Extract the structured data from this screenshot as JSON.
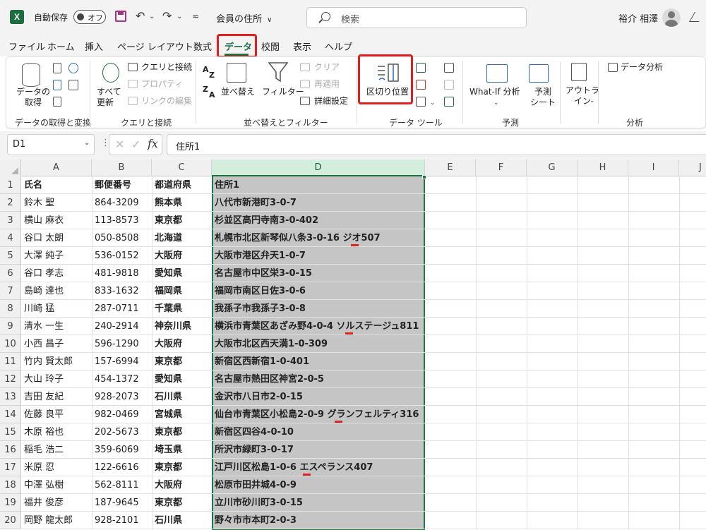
{
  "titlebar": {
    "logo": "X",
    "autosave_label": "自動保存",
    "autosave_state": "オフ",
    "filename": "会員の住所",
    "filename_chevron": "∨",
    "search_placeholder": "検索",
    "username": "裕介 相澤"
  },
  "tabs": [
    "ファイル",
    "ホーム",
    "挿入",
    "ページ レイアウト",
    "数式",
    "データ",
    "校閲",
    "表示",
    "ヘルプ"
  ],
  "active_tab": "データ",
  "ribbon": {
    "get_data": "データの\n取得",
    "group_get": "データの取得と変換",
    "queries_connections": "クエリと接続",
    "properties": "プロパティ",
    "edit_links": "リンクの編集",
    "refresh_all": "すべて\n更新",
    "group_queries": "クエリと接続",
    "sort": "並べ替え",
    "filter": "フィルター",
    "clear": "クリア",
    "reapply": "再適用",
    "advanced": "詳細設定",
    "group_sort": "並べ替えとフィルター",
    "text_to_columns": "区切り位置",
    "group_tools": "データ ツール",
    "what_if": "What-If 分析",
    "forecast_sheet": "予測\nシート",
    "group_forecast": "予測",
    "outline": "アウトラ\nイン",
    "data_analysis": "データ分析",
    "group_analysis": "分析",
    "sort_az_top": "A",
    "sort_az_bottom": "Z"
  },
  "formula_bar": {
    "namebox": "D1",
    "fx": "fx",
    "content": "住所1"
  },
  "columns": [
    "A",
    "B",
    "C",
    "D",
    "E",
    "F",
    "G",
    "H",
    "I",
    "J"
  ],
  "rows": [
    {
      "n": "1",
      "a": "氏名",
      "b": "郵便番号",
      "c": "都道府県",
      "d": "住所1"
    },
    {
      "n": "2",
      "a": "鈴木 聖",
      "b": "864-3209",
      "c": "熊本県",
      "d": "八代市新港町3-0-7"
    },
    {
      "n": "3",
      "a": "横山 麻衣",
      "b": "113-8573",
      "c": "東京都",
      "d": "杉並区高円寺南3-0-402"
    },
    {
      "n": "4",
      "a": "谷口 太朗",
      "b": "050-8508",
      "c": "北海道",
      "d": "札幌市北区新琴似八条3-0-16 ジオ507"
    },
    {
      "n": "5",
      "a": "大澤 純子",
      "b": "536-0152",
      "c": "大阪府",
      "d": "大阪市港区弁天1-0-7"
    },
    {
      "n": "6",
      "a": "谷口 孝志",
      "b": "481-9818",
      "c": "愛知県",
      "d": "名古屋市中区栄3-0-15"
    },
    {
      "n": "7",
      "a": "島崎 達也",
      "b": "833-1632",
      "c": "福岡県",
      "d": "福岡市南区日佐3-0-6"
    },
    {
      "n": "8",
      "a": "川崎 猛",
      "b": "287-0711",
      "c": "千葉県",
      "d": "我孫子市我孫子3-0-8"
    },
    {
      "n": "9",
      "a": "清水 一生",
      "b": "240-2914",
      "c": "神奈川県",
      "d": "横浜市青葉区あざみ野4-0-4 ソルステージュ811"
    },
    {
      "n": "10",
      "a": "小西 昌子",
      "b": "596-1290",
      "c": "大阪府",
      "d": "大阪市北区西天満1-0-309"
    },
    {
      "n": "11",
      "a": "竹内 賢太郎",
      "b": "157-6994",
      "c": "東京都",
      "d": "新宿区西新宿1-0-401"
    },
    {
      "n": "12",
      "a": "大山 玲子",
      "b": "454-1372",
      "c": "愛知県",
      "d": "名古屋市熱田区神宮2-0-5"
    },
    {
      "n": "13",
      "a": "吉田 友紀",
      "b": "928-2073",
      "c": "石川県",
      "d": "金沢市八日市2-0-15"
    },
    {
      "n": "14",
      "a": "佐藤 良平",
      "b": "982-0469",
      "c": "宮城県",
      "d": "仙台市青葉区小松島2-0-9 グランフェルティ316"
    },
    {
      "n": "15",
      "a": "木原 裕也",
      "b": "202-5673",
      "c": "東京都",
      "d": "新宿区四谷4-0-10"
    },
    {
      "n": "16",
      "a": "稲毛 浩二",
      "b": "359-6069",
      "c": "埼玉県",
      "d": "所沢市緑町3-0-17"
    },
    {
      "n": "17",
      "a": "米原 忍",
      "b": "122-6616",
      "c": "東京都",
      "d": "江戸川区松島1-0-6 エスペランス407"
    },
    {
      "n": "18",
      "a": "中澤 弘樹",
      "b": "562-8111",
      "c": "大阪府",
      "d": "松原市田井城4-0-9"
    },
    {
      "n": "19",
      "a": "福井 俊彦",
      "b": "187-9645",
      "c": "東京都",
      "d": "立川市砂川町3-0-15"
    },
    {
      "n": "20",
      "a": "岡野 龍太郎",
      "b": "928-2101",
      "c": "石川県",
      "d": "野々市市本町2-0-3"
    }
  ],
  "colors": {
    "excel_green": "#1d6f42",
    "highlight_red": "#e0201d",
    "selection_fill": "#c5c5c5"
  }
}
